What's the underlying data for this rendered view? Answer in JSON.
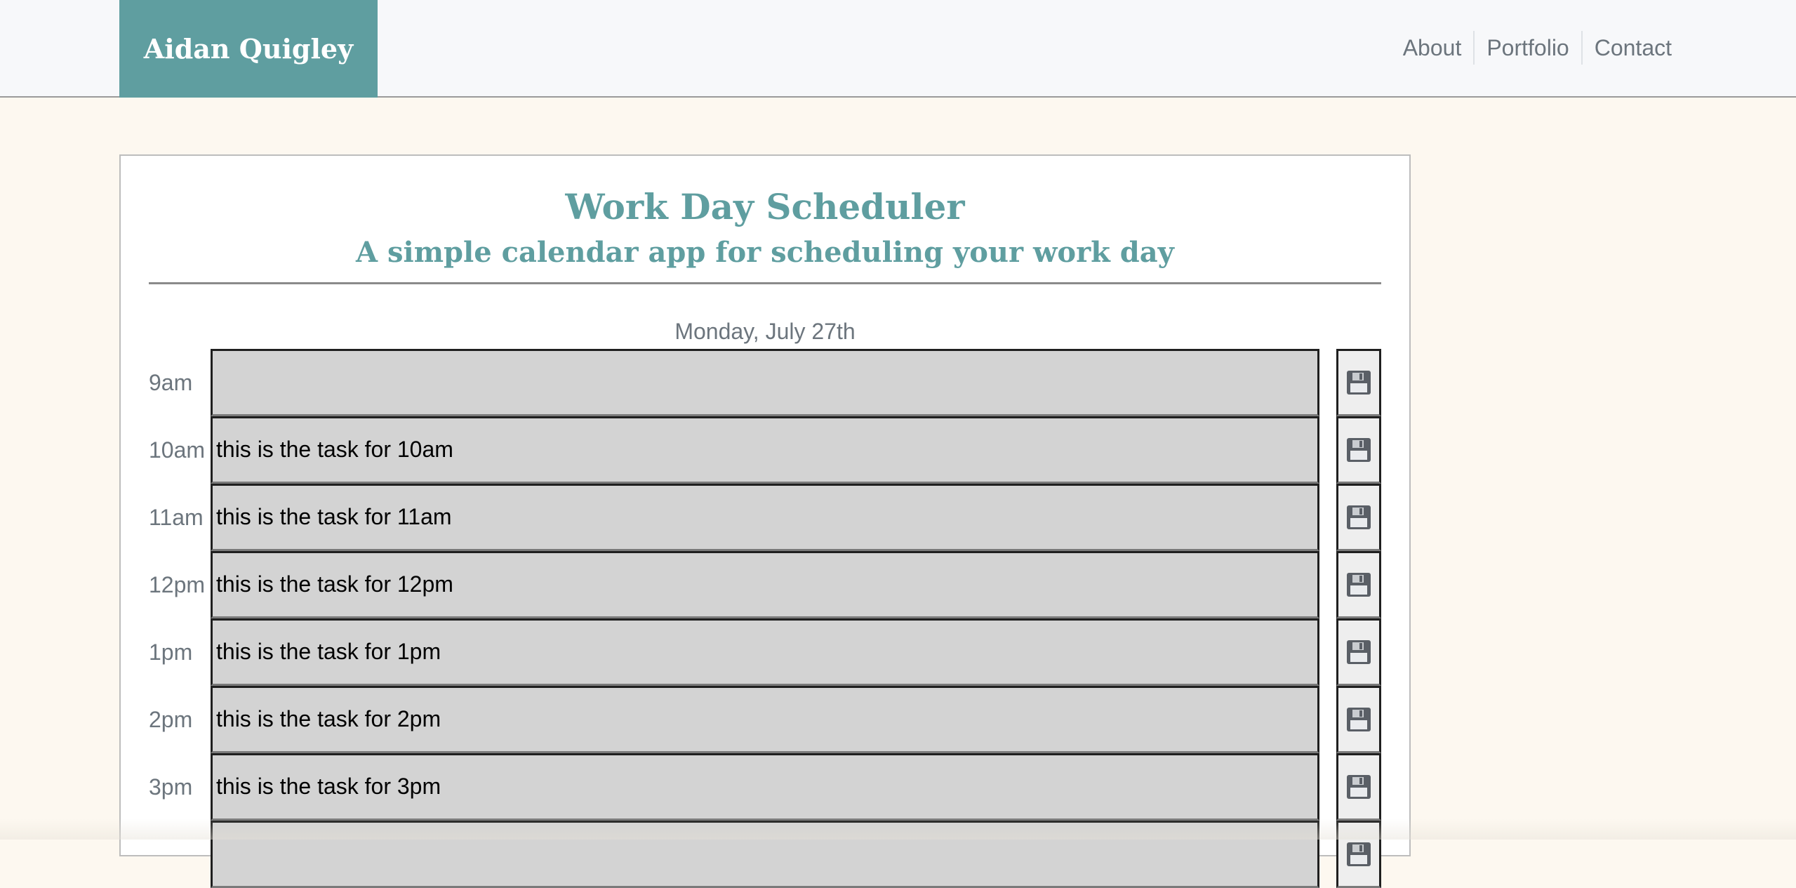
{
  "header": {
    "brand": "Aidan Quigley",
    "nav": [
      "About",
      "Portfolio",
      "Contact"
    ]
  },
  "scheduler": {
    "title": "Work Day Scheduler",
    "subtitle": "A simple calendar app for scheduling your work day",
    "date": "Monday, July 27th",
    "rows": [
      {
        "hour": "9am",
        "task": ""
      },
      {
        "hour": "10am",
        "task": "this is the task for 10am"
      },
      {
        "hour": "11am",
        "task": "this is the task for 11am"
      },
      {
        "hour": "12pm",
        "task": "this is the task for 12pm"
      },
      {
        "hour": "1pm",
        "task": "this is the task for 1pm"
      },
      {
        "hour": "2pm",
        "task": "this is the task for 2pm"
      },
      {
        "hour": "3pm",
        "task": "this is the task for 3pm"
      },
      {
        "hour": "",
        "task": ""
      }
    ],
    "save_icon": "floppy-disk-icon"
  },
  "colors": {
    "brand_bg": "#5f9ea0",
    "page_bg": "#fdf8f0",
    "nav_bg": "#f7f8fa",
    "task_bg": "#d3d3d3",
    "muted_text": "#6c757d"
  }
}
